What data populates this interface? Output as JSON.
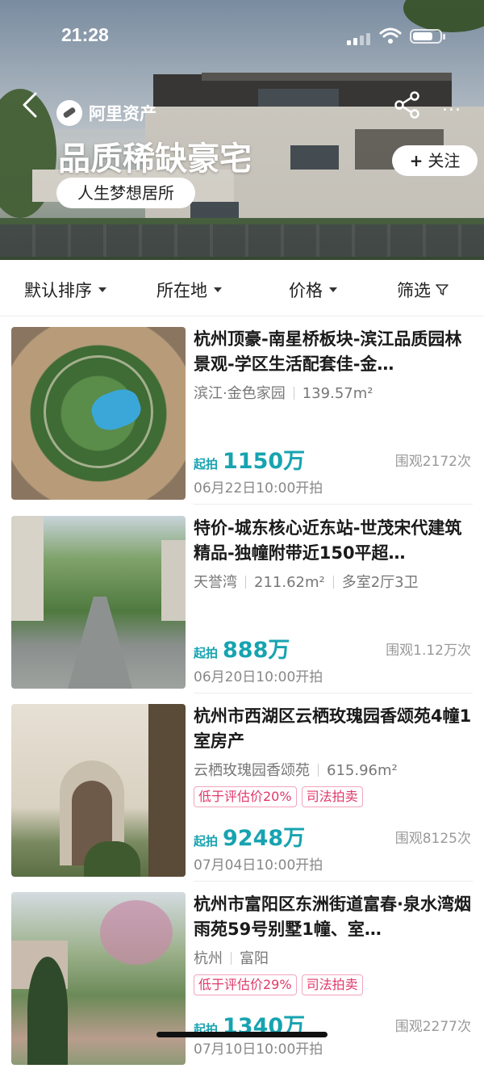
{
  "status_bar": {
    "time": "21:28"
  },
  "header": {
    "brand": "阿里资产",
    "title": "品质稀缺豪宅",
    "subtitle_pill": "人生梦想居所",
    "follow_label": "关注",
    "follow_plus": "+",
    "more": "..."
  },
  "filters": [
    {
      "label": "默认排序"
    },
    {
      "label": "所在地"
    },
    {
      "label": "价格"
    },
    {
      "label": "筛选"
    }
  ],
  "listings": [
    {
      "title": "杭州顶豪-南星桥板块-滨江品质园林景观-学区生活配套佳-金…",
      "meta": [
        "滨江·金色家园",
        "139.57m²"
      ],
      "tags": [],
      "price_label": "起拍",
      "price": "1150万",
      "views": "围观2172次",
      "start": "06月22日10:00开拍"
    },
    {
      "title": "特价-城东核心近东站-世茂宋代建筑精品-独幢附带近150平超…",
      "meta": [
        "天誉湾",
        "211.62m²",
        "多室2厅3卫"
      ],
      "tags": [],
      "price_label": "起拍",
      "price": "888万",
      "views": "围观1.12万次",
      "start": "06月20日10:00开拍"
    },
    {
      "title": "杭州市西湖区云栖玫瑰园香颂苑4幢1室房产",
      "meta": [
        "云栖玫瑰园香颂苑",
        "615.96m²"
      ],
      "tags": [
        "低于评估价20%",
        "司法拍卖"
      ],
      "price_label": "起拍",
      "price": "9248万",
      "views": "围观8125次",
      "start": "07月04日10:00开拍"
    },
    {
      "title": "杭州市富阳区东洲街道富春·泉水湾烟雨苑59号别墅1幢、室…",
      "meta": [
        "杭州",
        "富阳"
      ],
      "tags": [
        "低于评估价29%",
        "司法拍卖"
      ],
      "price_label": "起拍",
      "price": "1340万",
      "views": "围观2277次",
      "start": "07月10日10:00开拍"
    }
  ]
}
